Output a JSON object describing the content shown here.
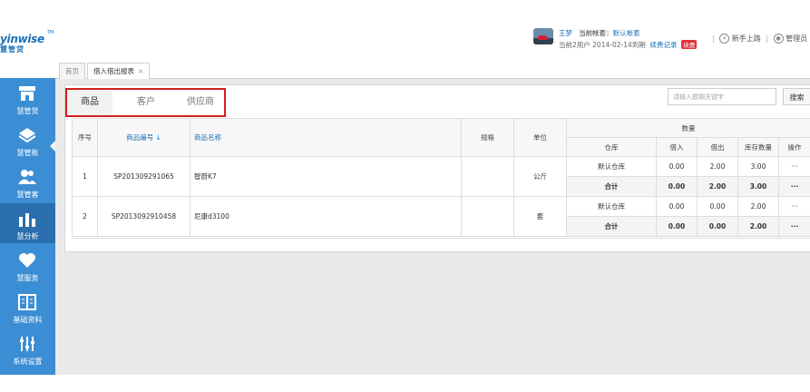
{
  "logo": {
    "brand": "yinwise",
    "tm": "TM",
    "sub": "慧管贷"
  },
  "user": {
    "name": "王梦",
    "account_label": "当前帐套：",
    "account_value": "默认帐套",
    "expiry": "当前2用户 2014-02-14到期",
    "renew": "续费记录",
    "badge": "续费"
  },
  "topright": {
    "guide": "新手上路",
    "admin": "管理员"
  },
  "sidebar": {
    "items": [
      {
        "label": "慧管货",
        "icon": "shop-icon"
      },
      {
        "label": "慧管账",
        "icon": "ledger-icon"
      },
      {
        "label": "慧管客",
        "icon": "users-icon"
      },
      {
        "label": "慧分析",
        "icon": "bar-chart-icon"
      },
      {
        "label": "慧服务",
        "icon": "heart-icon"
      },
      {
        "label": "基础资料",
        "icon": "book-icon"
      },
      {
        "label": "系统设置",
        "icon": "sliders-icon"
      }
    ]
  },
  "tabs": {
    "home": "首页",
    "report": "借入借出报表",
    "close": "×"
  },
  "subtabs": [
    "商品",
    "客户",
    "供应商"
  ],
  "search": {
    "placeholder": "请输入模糊关键字",
    "button": "搜索"
  },
  "table": {
    "headers": {
      "seq": "序号",
      "code": "商品编号",
      "sort_icon": "↓",
      "name": "商品名称",
      "spec": "规格",
      "unit": "单位",
      "qty": "数量",
      "warehouse": "仓库",
      "in": "借入",
      "out": "借出",
      "stock": "库存数量",
      "op": "操作"
    },
    "rows": [
      {
        "seq": "1",
        "code": "SP201309291065",
        "name": "智蔚K7",
        "spec": "",
        "unit": "公斤",
        "warehouse": "默认仓库",
        "in": "0.00",
        "out": "2.00",
        "stock": "3.00",
        "op": "···",
        "sum_label": "合计",
        "sum_in": "0.00",
        "sum_out": "2.00",
        "sum_stock": "3.00",
        "sum_op": "···"
      },
      {
        "seq": "2",
        "code": "SP2013092910458",
        "name": "尼康d3100",
        "spec": "",
        "unit": "套",
        "warehouse": "默认仓库",
        "in": "0.00",
        "out": "0.00",
        "stock": "2.00",
        "op": "···",
        "sum_label": "合计",
        "sum_in": "0.00",
        "sum_out": "0.00",
        "sum_stock": "2.00",
        "sum_op": "···"
      }
    ]
  },
  "colors": {
    "sidebar": "#3c8ed4",
    "sidebar_active": "#2b6fae",
    "highlight": "#d11f1f",
    "link": "#1b6fb8"
  }
}
